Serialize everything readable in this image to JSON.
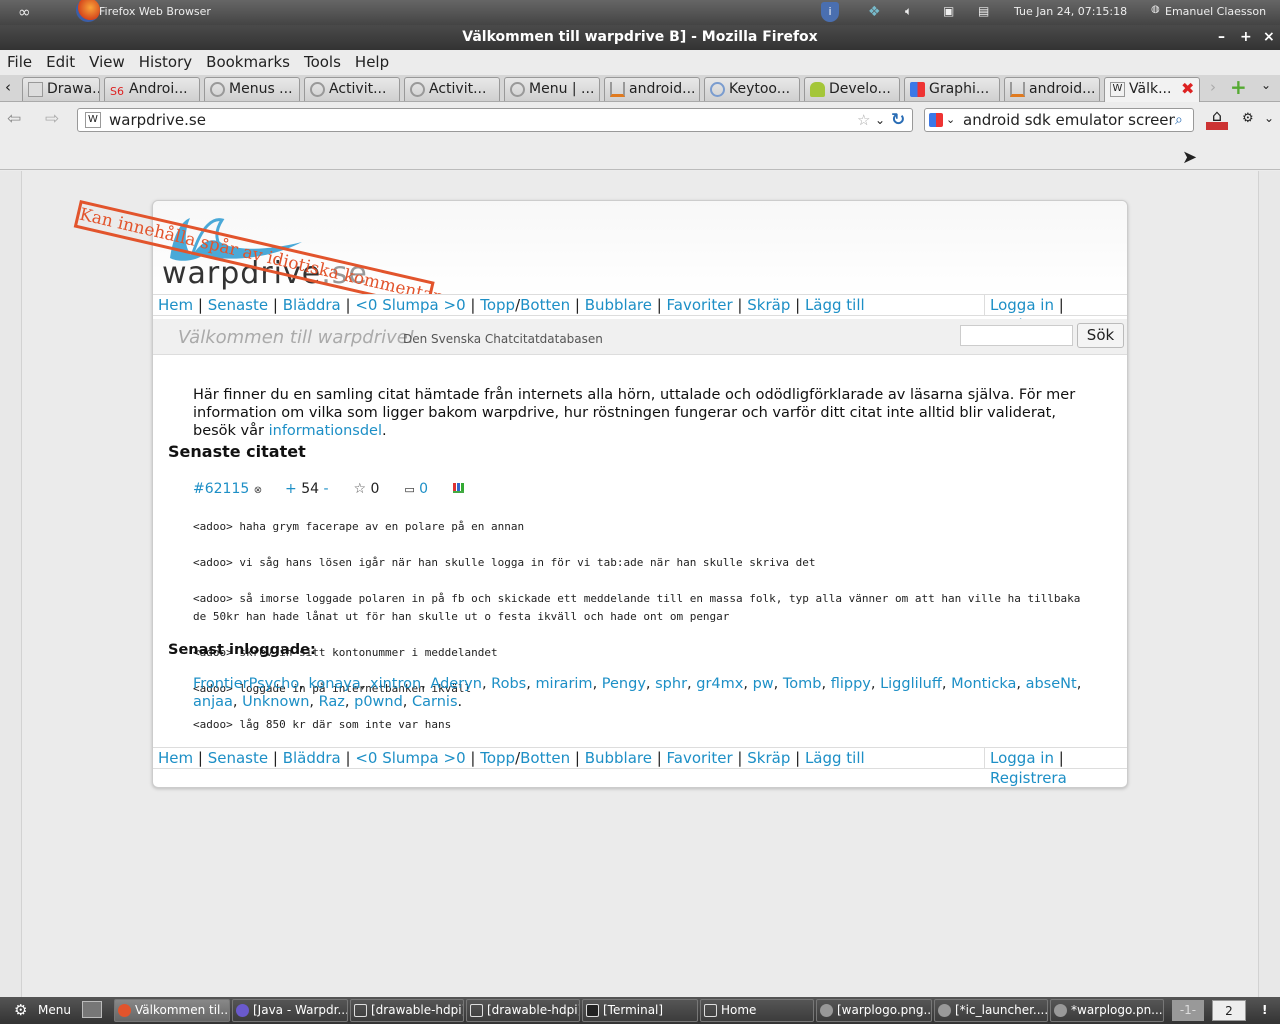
{
  "system": {
    "app_title": "Firefox Web Browser",
    "clock": "Tue Jan 24, 07:15:18",
    "user": "Emanuel Claesson"
  },
  "window": {
    "title": "Välkommen till warpdrive B] - Mozilla Firefox"
  },
  "menubar": [
    "File",
    "Edit",
    "View",
    "History",
    "Bookmarks",
    "Tools",
    "Help"
  ],
  "tabs": [
    {
      "label": "Drawa...",
      "icon": "page-icon"
    },
    {
      "label": "Androi...",
      "icon": "s6-icon"
    },
    {
      "label": "Menus ...",
      "icon": "android-dev-icon"
    },
    {
      "label": "Activit...",
      "icon": "android-dev-icon"
    },
    {
      "label": "Activit...",
      "icon": "android-dev-icon"
    },
    {
      "label": "Menu | ...",
      "icon": "android-dev-icon"
    },
    {
      "label": "android...",
      "icon": "stackoverflow-icon"
    },
    {
      "label": "Keytoo...",
      "icon": "chat-icon"
    },
    {
      "label": "Develo...",
      "icon": "android-icon"
    },
    {
      "label": "Graphi...",
      "icon": "google-icon"
    },
    {
      "label": "android...",
      "icon": "stackoverflow-icon"
    },
    {
      "label": "Välk...",
      "icon": "warpdrive-icon"
    }
  ],
  "navbar": {
    "url": "warpdrive.se",
    "search": "android sdk emulator screen"
  },
  "site": {
    "stamp": "Kan innehålla spår av idiotiska kommentarer!",
    "logo_text": "warpdrive",
    "logo_suffix": ".se",
    "nav": {
      "hem": "Hem",
      "senaste": "Senaste",
      "bladdra": "Bläddra",
      "slumpa": "<0 Slumpa >0",
      "topp": "Topp",
      "botten": "Botten",
      "bubblare": "Bubblare",
      "favoriter": "Favoriter",
      "skrap": "Skräp",
      "lagg_till": "Lägg till",
      "logga_in": "Logga in",
      "registrera": "Registrera"
    },
    "welcome": "Välkommen till warpdrive!",
    "tagline": "Den Svenska Chatcitatdatabasen",
    "search_button": "Sök",
    "intro": "Här finner du en samling citat hämtade från internets alla hörn, uttalade och odödligförklarade av läsarna själva. För mer information om vilka som ligger bakom warpdrive, hur röstningen fungerar och varför ditt citat inte alltid blir validerat, besök vår",
    "intro_link": "informationsdel",
    "latest_heading": "Senaste citatet",
    "quote": {
      "id": "#62115",
      "plus": "+",
      "score": "54",
      "minus": "-",
      "favs": "0",
      "comments": "0",
      "lines": [
        "<adoo> haha grym facerape av en polare på en annan",
        "<adoo> vi såg hans lösen igår när han skulle logga in för vi tab:ade när han skulle skriva det",
        "<adoo> så imorse loggade polaren in på fb och skickade ett meddelande till en massa folk, typ alla vänner om att han ville ha tillbaka de 50kr han hade lånat ut för han skulle ut o festa ikväll och hade ont om pengar",
        "<adoo> skrev in sitt kontonummer i meddelandet",
        "<adoo> loggade in på internetbanken ikväll",
        "<adoo> låg 850 kr där som inte var hans"
      ]
    },
    "logged_heading": "Senast inloggade:",
    "users": [
      "FrontierPsycho",
      "konaya",
      "xintron",
      "Aderyn",
      "Robs",
      "mirarim",
      "Pengy",
      "sphr",
      "gr4mx",
      "pw",
      "Tomb",
      "flippy",
      "Liggliluff",
      "Monticka",
      "abseNt",
      "anjaa",
      "Unknown",
      "Raz",
      "p0wnd",
      "Carnis"
    ]
  },
  "taskbar": {
    "menu": "Menu",
    "tasks": [
      "Välkommen til...",
      "[Java - Warpdr...",
      "[drawable-hdpi]",
      "[drawable-hdpi]",
      "[Terminal]",
      "Home",
      "[warplogo.png...",
      "[*ic_launcher....",
      "*warplogo.pn..."
    ],
    "workspace1": "-1-",
    "workspace2": "2",
    "alert": "!"
  }
}
